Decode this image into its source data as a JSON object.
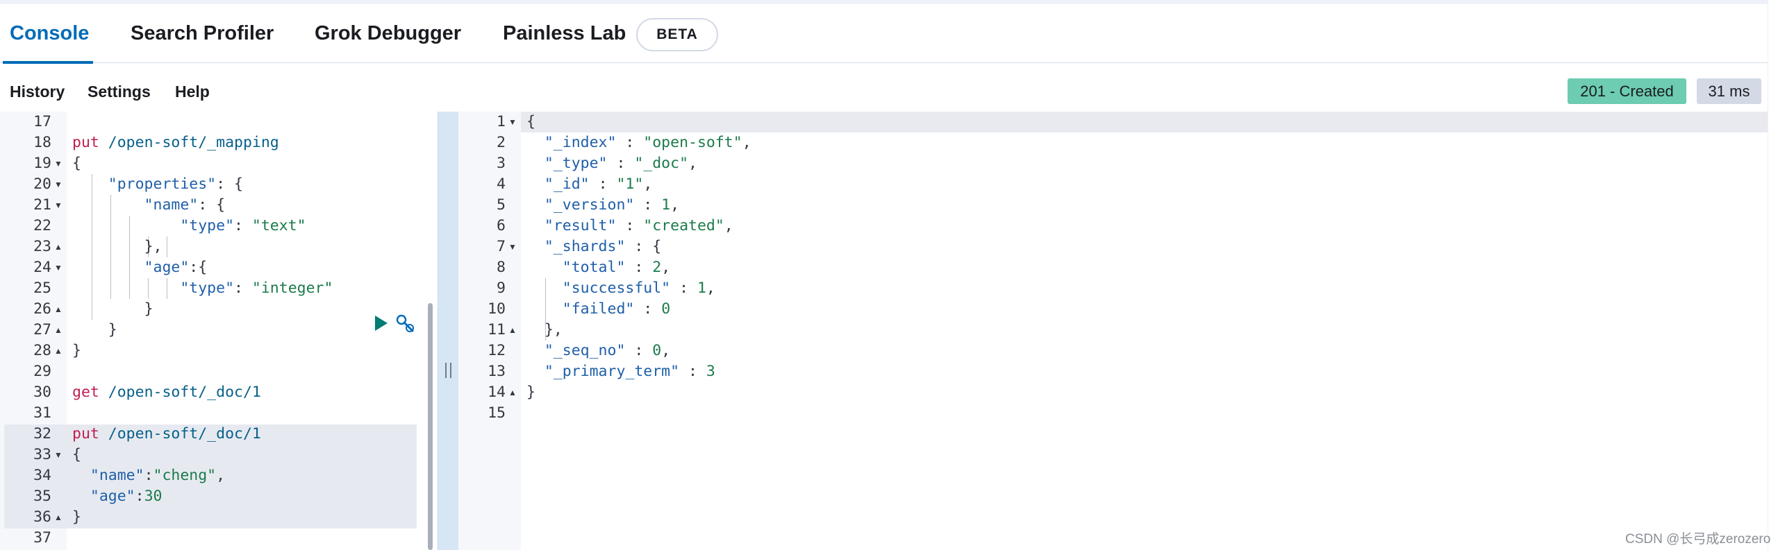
{
  "tabs": [
    {
      "label": "Console",
      "active": true
    },
    {
      "label": "Search Profiler"
    },
    {
      "label": "Grok Debugger"
    },
    {
      "label": "Painless Lab"
    }
  ],
  "beta_badge": "BETA",
  "subnav": {
    "history": "History",
    "settings": "Settings",
    "help": "Help"
  },
  "status": {
    "code": "201 - Created",
    "time": "31 ms"
  },
  "colors": {
    "accent": "#006bb8",
    "status_ok": "#6dccb1",
    "keyword": "#c11e4f",
    "string": "#1c7a4a"
  },
  "icons": {
    "run": "play-icon",
    "tools": "wrench-icon",
    "fold_open": "triangle-down-icon",
    "fold_close": "triangle-up-icon"
  },
  "request_editor": {
    "lines": [
      {
        "n": "17",
        "fold": "",
        "text": ""
      },
      {
        "n": "18",
        "fold": "",
        "text": "put /open-soft/_mapping"
      },
      {
        "n": "19",
        "fold": "open",
        "text": "{"
      },
      {
        "n": "20",
        "fold": "open",
        "text": "    \"properties\": {"
      },
      {
        "n": "21",
        "fold": "open",
        "text": "        \"name\": {"
      },
      {
        "n": "22",
        "fold": "",
        "text": "            \"type\": \"text\""
      },
      {
        "n": "23",
        "fold": "close",
        "text": "        },"
      },
      {
        "n": "24",
        "fold": "open",
        "text": "        \"age\":{"
      },
      {
        "n": "25",
        "fold": "",
        "text": "            \"type\": \"integer\""
      },
      {
        "n": "26",
        "fold": "close",
        "text": "        }"
      },
      {
        "n": "27",
        "fold": "close",
        "text": "    }"
      },
      {
        "n": "28",
        "fold": "close",
        "text": "}"
      },
      {
        "n": "29",
        "fold": "",
        "text": ""
      },
      {
        "n": "30",
        "fold": "",
        "text": "get /open-soft/_doc/1"
      },
      {
        "n": "31",
        "fold": "",
        "text": ""
      },
      {
        "n": "32",
        "fold": "",
        "text": "put /open-soft/_doc/1"
      },
      {
        "n": "33",
        "fold": "open",
        "text": "{"
      },
      {
        "n": "34",
        "fold": "",
        "text": "  \"name\":\"cheng\","
      },
      {
        "n": "35",
        "fold": "",
        "text": "  \"age\":30"
      },
      {
        "n": "36",
        "fold": "close",
        "text": "}"
      },
      {
        "n": "37",
        "fold": "",
        "text": ""
      }
    ]
  },
  "response_editor": {
    "lines": [
      {
        "n": "1",
        "fold": "open",
        "text": "{"
      },
      {
        "n": "2",
        "fold": "",
        "text": "  \"_index\" : \"open-soft\","
      },
      {
        "n": "3",
        "fold": "",
        "text": "  \"_type\" : \"_doc\","
      },
      {
        "n": "4",
        "fold": "",
        "text": "  \"_id\" : \"1\","
      },
      {
        "n": "5",
        "fold": "",
        "text": "  \"_version\" : 1,"
      },
      {
        "n": "6",
        "fold": "",
        "text": "  \"result\" : \"created\","
      },
      {
        "n": "7",
        "fold": "open",
        "text": "  \"_shards\" : {"
      },
      {
        "n": "8",
        "fold": "",
        "text": "    \"total\" : 2,"
      },
      {
        "n": "9",
        "fold": "",
        "text": "    \"successful\" : 1,"
      },
      {
        "n": "10",
        "fold": "",
        "text": "    \"failed\" : 0"
      },
      {
        "n": "11",
        "fold": "close",
        "text": "  },"
      },
      {
        "n": "12",
        "fold": "",
        "text": "  \"_seq_no\" : 0,"
      },
      {
        "n": "13",
        "fold": "",
        "text": "  \"_primary_term\" : 3"
      },
      {
        "n": "14",
        "fold": "close",
        "text": "}"
      },
      {
        "n": "15",
        "fold": "",
        "text": ""
      }
    ]
  },
  "watermark": "CSDN @长弓成zerozero"
}
